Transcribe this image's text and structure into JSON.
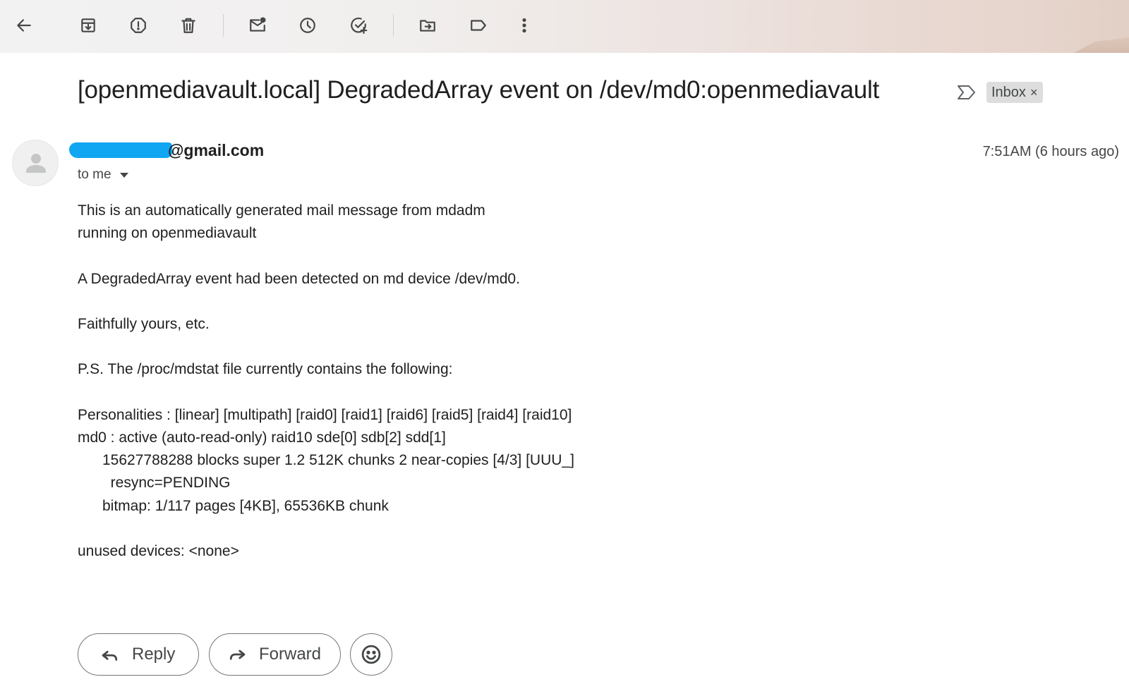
{
  "toolbar": {
    "buttons": [
      {
        "icon": "back-arrow-icon"
      },
      {
        "icon": "archive-icon"
      },
      {
        "icon": "report-spam-icon"
      },
      {
        "icon": "delete-icon"
      },
      {
        "icon": "mark-unread-icon"
      },
      {
        "icon": "snooze-icon"
      },
      {
        "icon": "add-to-tasks-icon"
      },
      {
        "icon": "move-to-icon"
      },
      {
        "icon": "label-icon"
      },
      {
        "icon": "more-vert-icon"
      }
    ]
  },
  "email": {
    "subject": "[openmediavault.local] DegradedArray event on /dev/md0:openmediavault",
    "label": "Inbox",
    "label_close": "×",
    "sender_visible": "@gmail.com",
    "recipient": "to me",
    "time": "7:51AM (6 hours ago)",
    "body": "This is an automatically generated mail message from mdadm\nrunning on openmediavault\n\nA DegradedArray event had been detected on md device /dev/md0.\n\nFaithfully yours, etc.\n\nP.S. The /proc/mdstat file currently contains the following:\n\nPersonalities : [linear] [multipath] [raid0] [raid1] [raid6] [raid5] [raid4] [raid10]\nmd0 : active (auto-read-only) raid10 sde[0] sdb[2] sdd[1]\n      15627788288 blocks super 1.2 512K chunks 2 near-copies [4/3] [UUU_]\n        resync=PENDING\n      bitmap: 1/117 pages [4KB], 65536KB chunk\n\nunused devices: <none>"
  },
  "actions": {
    "reply_label": "Reply",
    "forward_label": "Forward"
  },
  "colors": {
    "redaction": "#10a6f2",
    "label_chip_bg": "#dddddd",
    "icon_gray": "#444746"
  }
}
